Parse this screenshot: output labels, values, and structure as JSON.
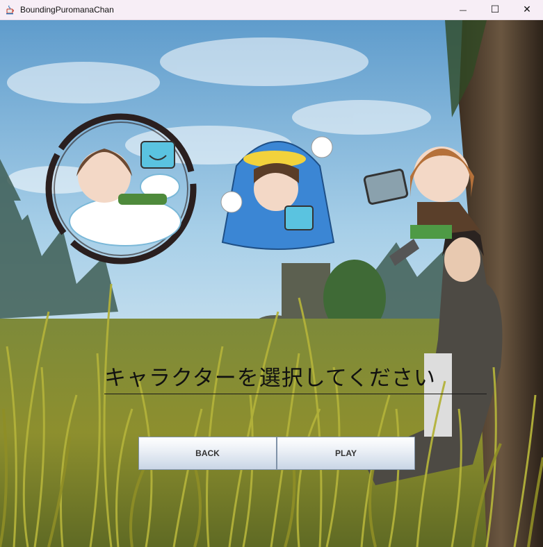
{
  "window": {
    "title": "BoundingPuromanaChan",
    "minimize_glyph": "—",
    "maximize_glyph": "☐",
    "close_glyph": "✕"
  },
  "screen": {
    "prompt": "キャラクターを選択してください",
    "back_label": "BACK",
    "play_label": "PLAY"
  },
  "icons": {
    "app": "java-cup-icon",
    "characters": [
      "character-cloud-in-brush-circle",
      "character-blue-bird-hood",
      "character-with-tablet"
    ]
  },
  "colors": {
    "titlebar": "#f7eef6",
    "sky": "#9cc8e6",
    "grass": "#9b9a2c",
    "button_border": "#7f92a8",
    "text": "#111111"
  }
}
